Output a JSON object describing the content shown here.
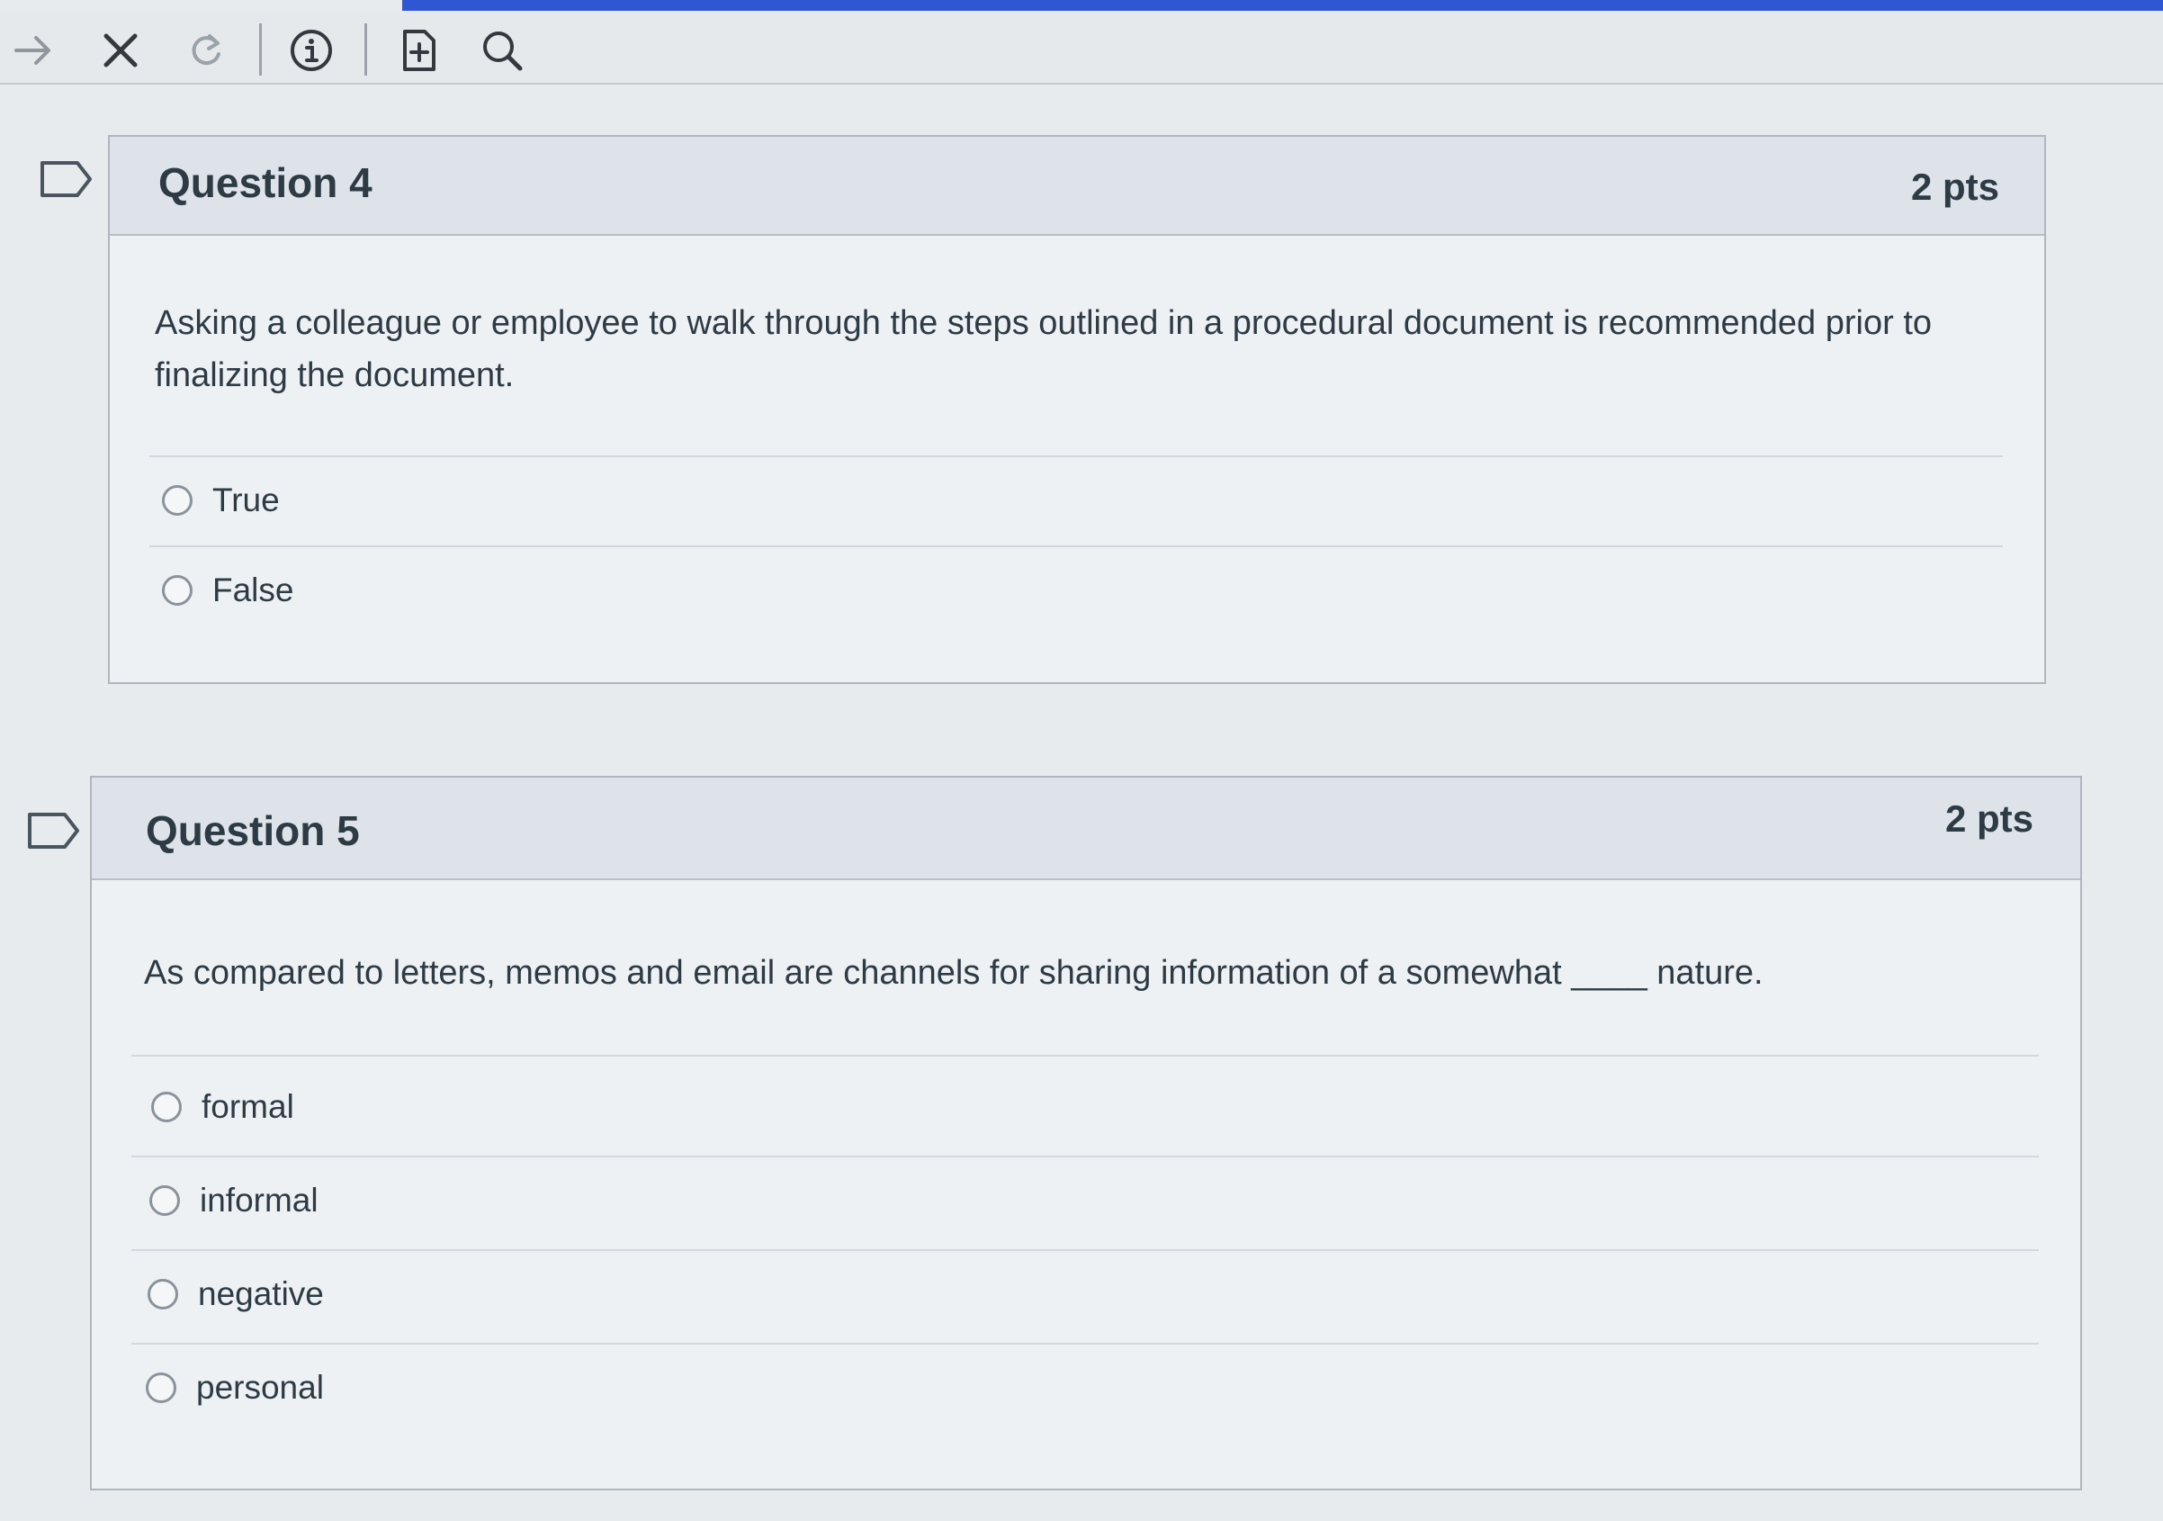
{
  "toolbar": {
    "icons": [
      "forward-arrow-icon",
      "close-icon",
      "reload-icon",
      "info-icon",
      "add-page-icon",
      "search-icon"
    ]
  },
  "questions": [
    {
      "title": "Question 4",
      "points": "2 pts",
      "text": "Asking a colleague or employee to walk through the steps outlined in a procedural document is recommended prior to finalizing the document.",
      "answers": [
        "True",
        "False"
      ]
    },
    {
      "title": "Question 5",
      "points": "2 pts",
      "text": "As compared to letters, memos and email are channels for sharing information of a somewhat ____ nature.",
      "answers": [
        "formal",
        "informal",
        "negative",
        "personal"
      ]
    }
  ],
  "colors": {
    "accent": "#2f57d3",
    "header_bg": "#dee3ea",
    "body_bg": "#eef1f4",
    "text": "#2d3b45"
  }
}
